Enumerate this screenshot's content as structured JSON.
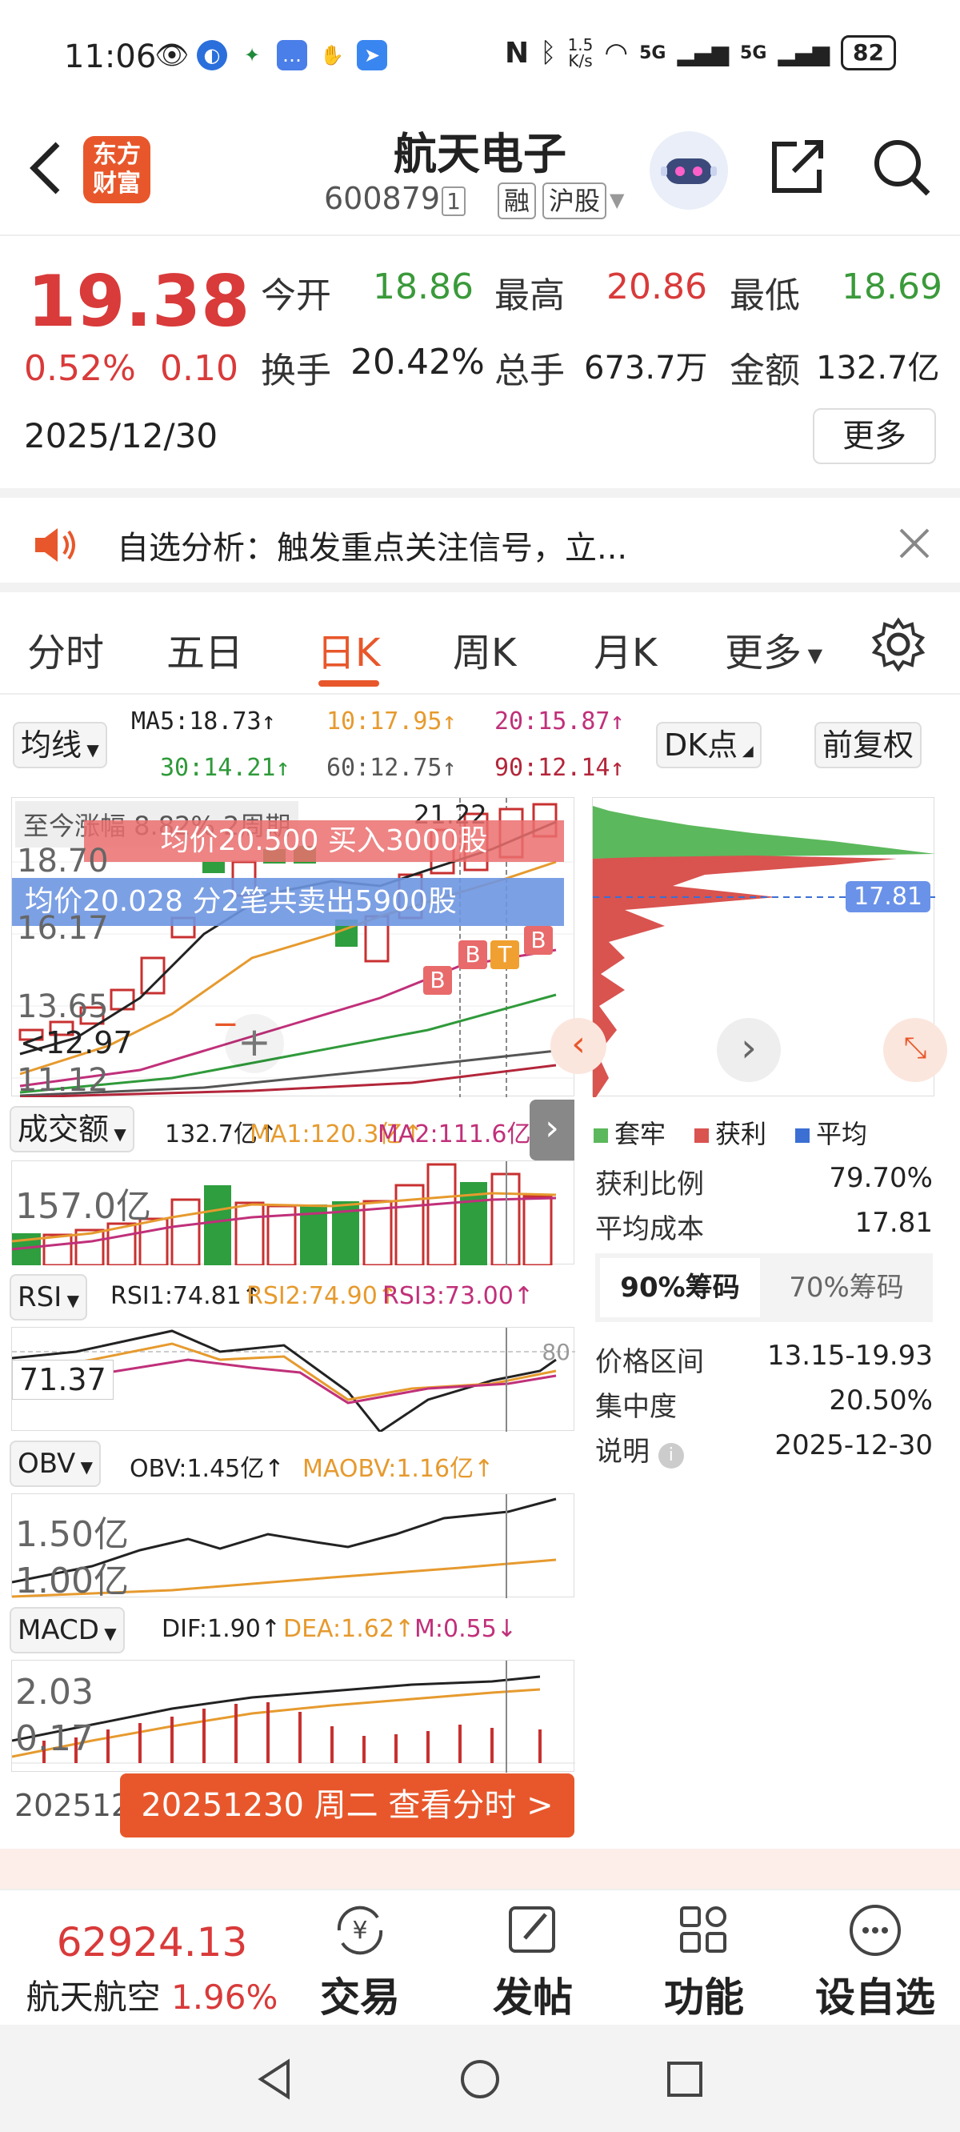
{
  "status_bar": {
    "time": "11:06",
    "net_speed_value": "1.5",
    "net_speed_unit": "K/s",
    "network1": "5G",
    "network2": "5G",
    "battery": "82"
  },
  "header": {
    "back_icon": "chevron-left-icon",
    "logo_line1": "东方",
    "logo_line2": "财富",
    "title": "航天电子",
    "code": "600879",
    "code_suffix": "1",
    "tag1": "融",
    "tag2": "沪股",
    "share_icon": "share-icon",
    "search_icon": "search-icon"
  },
  "quote": {
    "price": "19.38",
    "change_pct": "0.52%",
    "change": "0.10",
    "date": "2025/12/30",
    "open_label": "今开",
    "open": "18.86",
    "high_label": "最高",
    "high": "20.86",
    "low_label": "最低",
    "low": "18.69",
    "turnover_label": "换手",
    "turnover": "20.42%",
    "volume_label": "总手",
    "volume": "673.7万",
    "amount_label": "金额",
    "amount": "132.7亿",
    "more_label": "更多"
  },
  "notice": {
    "text": "自选分析：触发重点关注信号，立...",
    "speaker_icon": "speaker-icon",
    "close_icon": "close-icon"
  },
  "tabs": [
    {
      "label": "分时"
    },
    {
      "label": "五日"
    },
    {
      "label": "日K",
      "active": true
    },
    {
      "label": "周K"
    },
    {
      "label": "月K"
    },
    {
      "label": "更多"
    }
  ],
  "indicators": {
    "ma_selector": "均线",
    "ma5": "MA5:18.73",
    "ma10": "10:17.95",
    "ma20": "20:15.87",
    "ma30": "30:14.21",
    "ma60": "60:12.75",
    "ma90": "90:12.14",
    "dk_label": "DK点",
    "adjust_label": "前复权"
  },
  "kline": {
    "overlay_text": "至今涨幅 8.82% 2周期",
    "high_marker": "21.22",
    "low_marker": "12.97",
    "buy_banner": "均价20.500 买入3000股",
    "sell_banner": "均价20.028 分2笔共卖出5900股",
    "y_ticks": [
      "18.70",
      "16.17",
      "13.65",
      "11.12"
    ],
    "signals": [
      "B",
      "B",
      "T",
      "B"
    ]
  },
  "volume": {
    "label": "成交额",
    "value": "132.7亿",
    "ma1": "MA1:120.3亿",
    "ma2": "MA2:111.6亿",
    "y_tick": "157.0亿"
  },
  "rsi": {
    "label": "RSI",
    "rsi1": "RSI1:74.81",
    "rsi2": "RSI2:74.90",
    "rsi3": "RSI3:73.00",
    "cursor_value": "71.37",
    "level80": "80"
  },
  "obv": {
    "label": "OBV",
    "obv": "OBV:1.45亿",
    "maobv": "MAOBV:1.16亿",
    "y1": "1.50亿",
    "y2": "1.00亿"
  },
  "macd": {
    "label": "MACD",
    "dif": "DIF:1.90",
    "dea": "DEA:1.62",
    "m": "M:0.55",
    "y1": "2.03",
    "y2": "0.17"
  },
  "footer_chart": {
    "date_left": "202512",
    "view_btn": "20251230 周二 查看分时 >"
  },
  "chips": {
    "current_price_tag": "17.81",
    "legend": [
      {
        "label": "套牢",
        "color": "#5cb85c"
      },
      {
        "label": "获利",
        "color": "#d9534f"
      },
      {
        "label": "平均",
        "color": "#3b6fd4"
      }
    ],
    "profit_ratio_label": "获利比例",
    "profit_ratio": "79.70%",
    "avg_cost_label": "平均成本",
    "avg_cost": "17.81",
    "tab90": "90%筹码",
    "tab70": "70%筹码",
    "range_label": "价格区间",
    "range": "13.15-19.93",
    "concentration_label": "集中度",
    "concentration": "20.50%",
    "note_label": "说明",
    "note": "2025-12-30"
  },
  "bottom_nav": {
    "index_value": "62924.13",
    "index_name": "航天航空",
    "index_pct": "1.96%",
    "trade": "交易",
    "post": "发帖",
    "function": "功能",
    "watchlist": "设自选"
  }
}
